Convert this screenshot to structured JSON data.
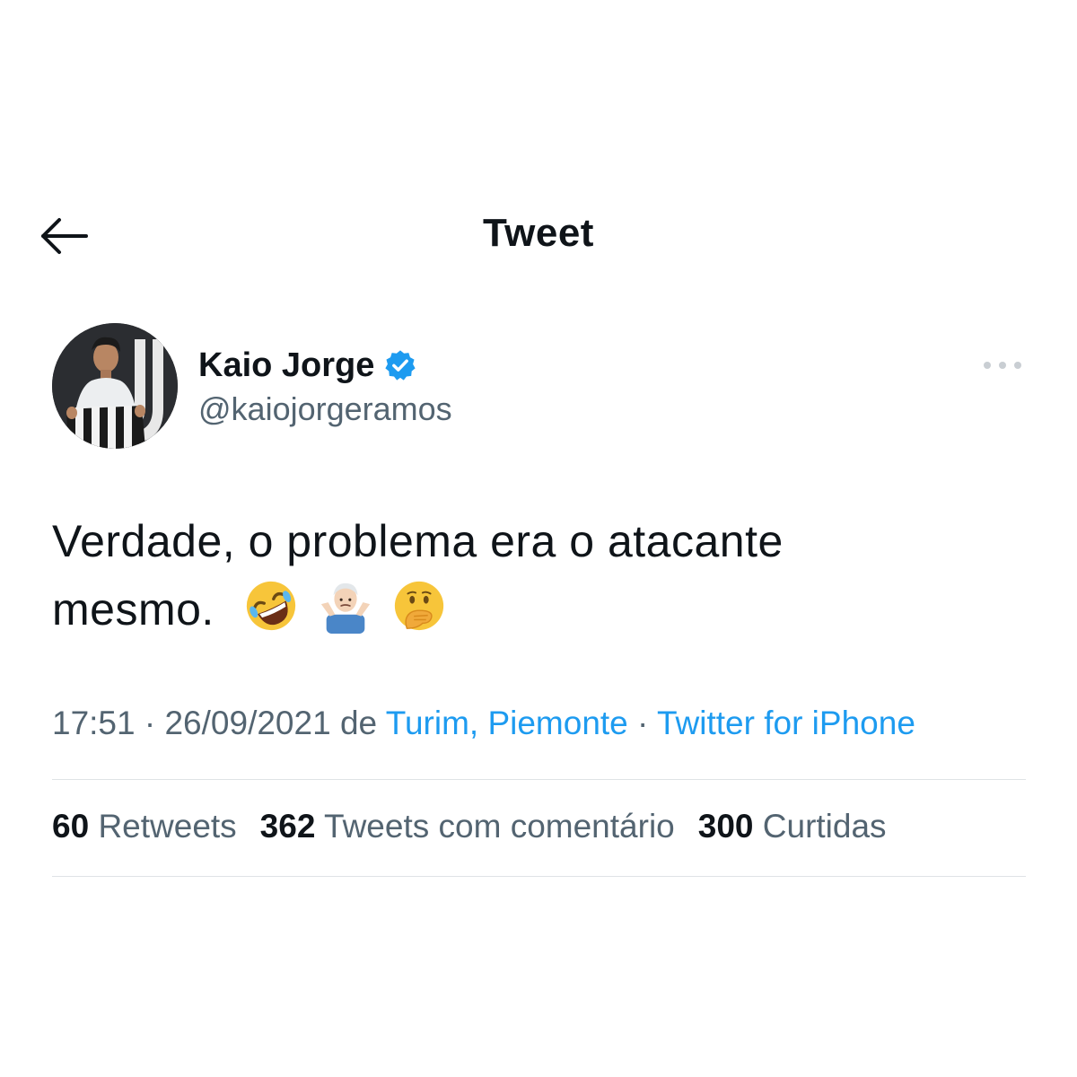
{
  "header": {
    "title": "Tweet",
    "back_icon": "arrow-left-icon"
  },
  "author": {
    "name": "Kaio Jorge",
    "handle": "@kaiojorgeramos",
    "verified": true,
    "verified_color": "#1d9bf0"
  },
  "tweet": {
    "text_line1": "Verdade, o problema era o atacante",
    "text_line2": "mesmo.",
    "emojis": [
      "rolling-on-floor-laughing-emoji",
      "person-shrugging-emoji",
      "face-with-hand-over-mouth-emoji"
    ]
  },
  "meta": {
    "time": "17:51",
    "separator": " · ",
    "date": "26/09/2021",
    "location_prefix": " de ",
    "location": "Turim, Piemonte",
    "source_separator": " · ",
    "source": "Twitter for iPhone"
  },
  "stats": [
    {
      "count": "60",
      "label": "Retweets"
    },
    {
      "count": "362",
      "label": "Tweets com comentário"
    },
    {
      "count": "300",
      "label": "Curtidas"
    }
  ],
  "colors": {
    "link": "#1d9bf0",
    "secondary_text": "#536471",
    "primary_text": "#0f1419",
    "divider": "#dfe3e6"
  }
}
